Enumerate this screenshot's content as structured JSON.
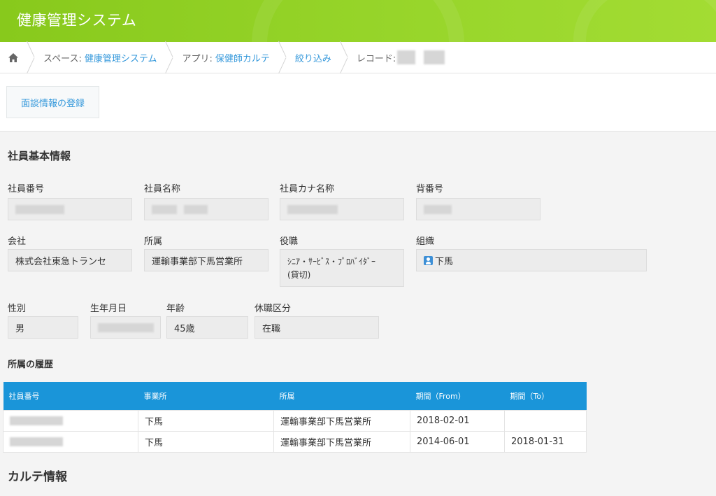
{
  "app": {
    "title": "健康管理システム"
  },
  "breadcrumb": {
    "home_icon": "home-icon",
    "space_label": "スペース:",
    "space_value": "健康管理システム",
    "app_label": "アプリ:",
    "app_value": "保健師カルテ",
    "filter": "絞り込み",
    "record_label": "レコード:"
  },
  "toolbar": {
    "register_button": "面談情報の登録"
  },
  "employee_section": {
    "title": "社員基本情報",
    "fields": {
      "emp_number_label": "社員番号",
      "emp_name_label": "社員名称",
      "emp_kana_label": "社員カナ名称",
      "back_number_label": "背番号",
      "company_label": "会社",
      "company_value": "株式会社東急トランセ",
      "department_label": "所属",
      "department_value": "運輸事業部下馬営業所",
      "position_label": "役職",
      "position_value_line1": "ｼﾆｱ・ｻｰﾋﾞｽ・ﾌﾟﾛﾊﾞｲﾀﾞｰ",
      "position_value_line2": "(貸切)",
      "organization_label": "組織",
      "organization_value": "下馬",
      "gender_label": "性別",
      "gender_value": "男",
      "birthdate_label": "生年月日",
      "age_label": "年齢",
      "age_value": "45歳",
      "leave_label": "休職区分",
      "leave_value": "在職"
    }
  },
  "history": {
    "title": "所属の履歴",
    "columns": [
      "社員番号",
      "事業所",
      "所属",
      "期間（From）",
      "期間（To）"
    ],
    "rows": [
      {
        "office": "下馬",
        "department": "運輸事業部下馬営業所",
        "from": "2018-02-01",
        "to": ""
      },
      {
        "office": "下馬",
        "department": "運輸事業部下馬営業所",
        "from": "2014-06-01",
        "to": "2018-01-31"
      }
    ]
  },
  "karte_section": {
    "title": "カルテ情報"
  },
  "colors": {
    "header_green": "#8fcf23",
    "table_header_blue": "#1a95d9",
    "link_blue": "#3498db"
  }
}
